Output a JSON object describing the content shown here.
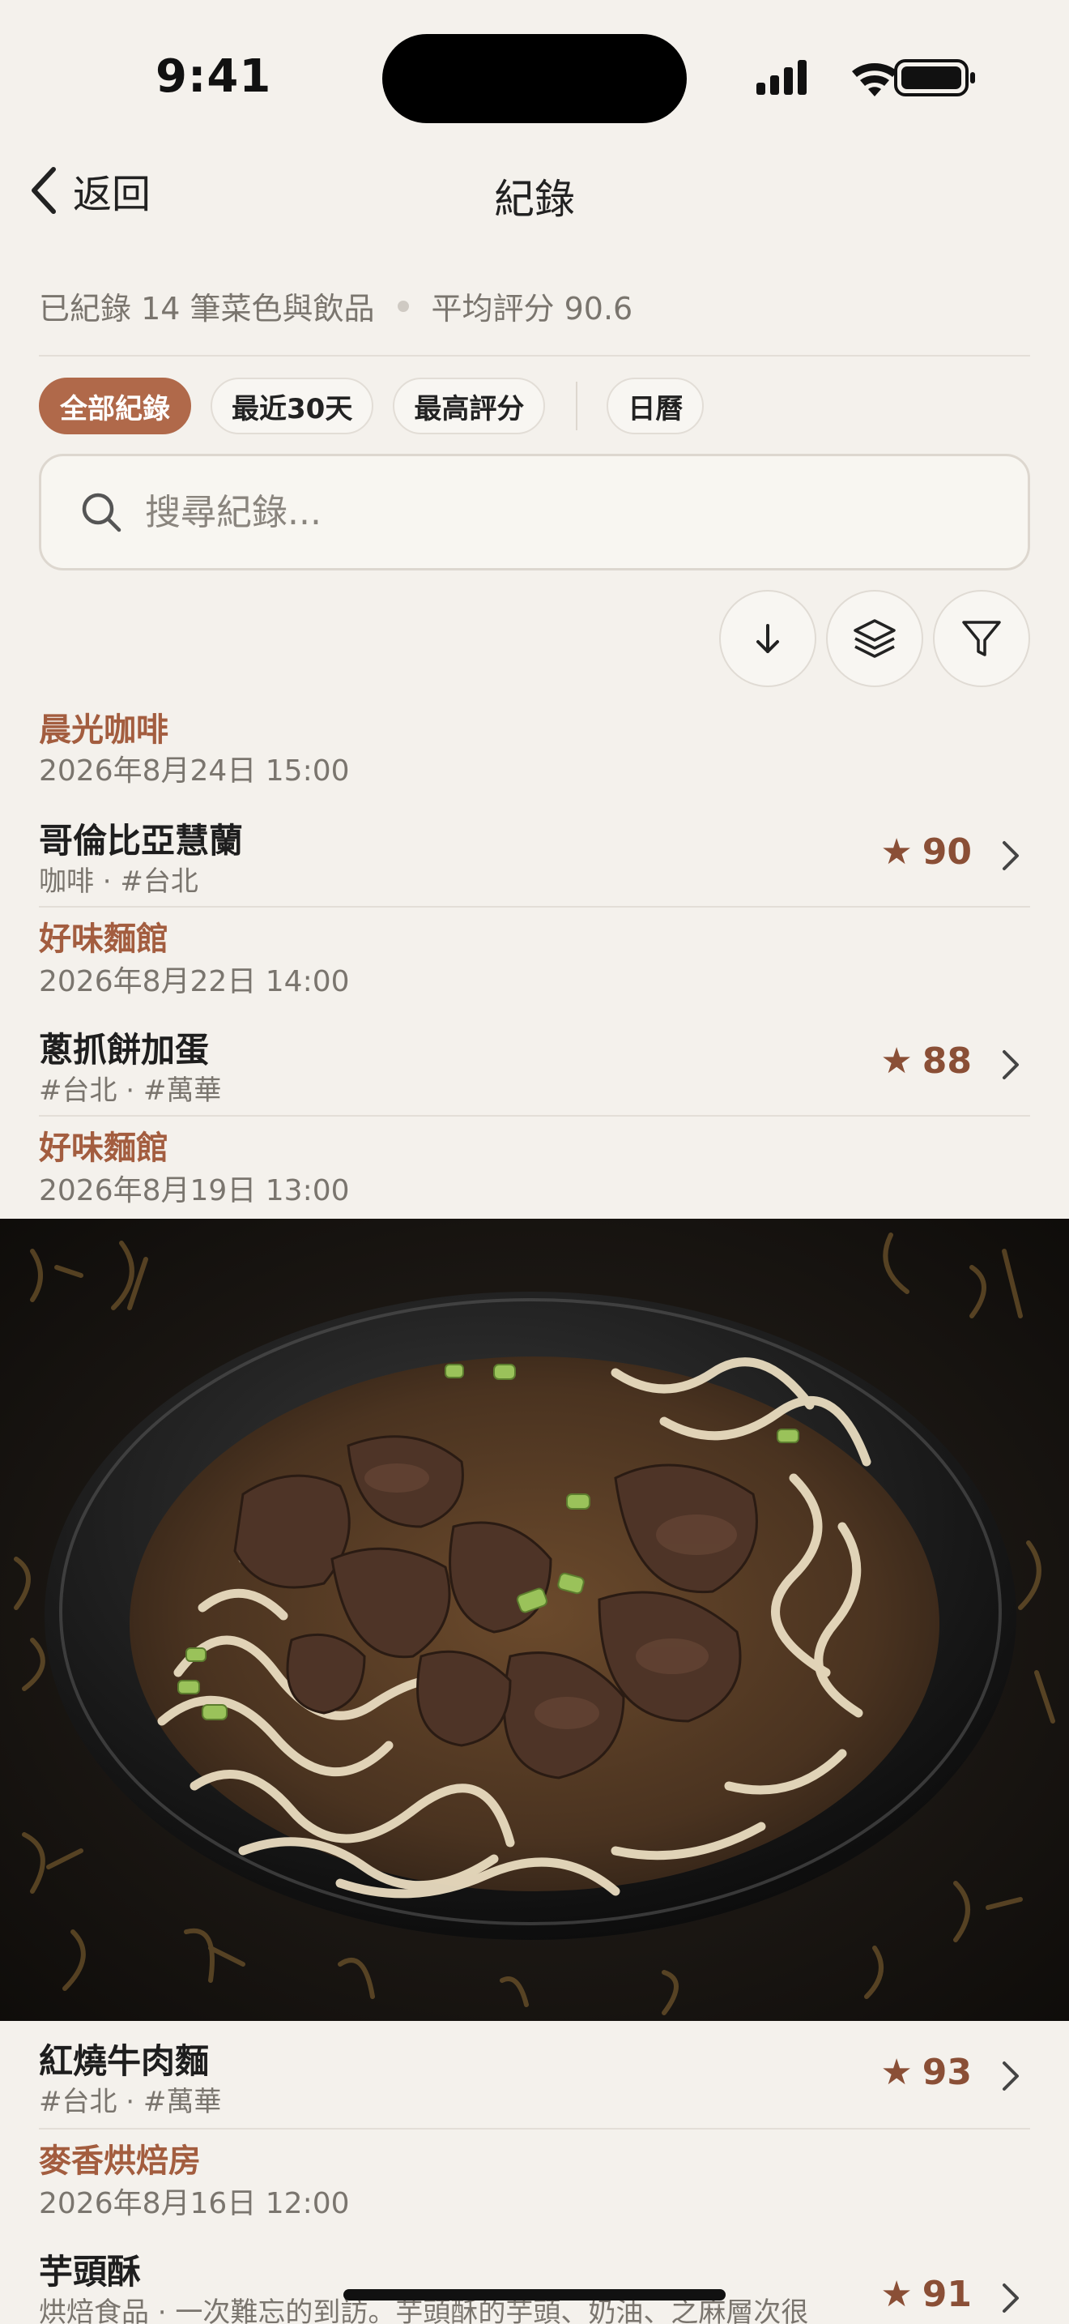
{
  "status_bar": {
    "time": "9:41"
  },
  "nav": {
    "back_label": "返回",
    "title": "紀錄"
  },
  "summary": {
    "count_text": "已紀錄 14 筆菜色與飲品",
    "avg_text": "平均評分 90.6"
  },
  "filters": [
    "全部紀錄",
    "最近30天",
    "最高評分",
    "日曆"
  ],
  "search": {
    "placeholder": "搜尋紀錄..."
  },
  "tools": [
    "arrow-down-icon",
    "layers-icon",
    "filter-icon"
  ],
  "entries": [
    {
      "place": "晨光咖啡",
      "datetime": "2026年8月24日 15:00",
      "name": "哥倫比亞慧蘭",
      "tags": "咖啡 · #台北",
      "score": "90"
    },
    {
      "place": "好味麵館",
      "datetime": "2026年8月22日 14:00",
      "name": "蔥抓餅加蛋",
      "tags": "#台北 · #萬華",
      "score": "88"
    },
    {
      "place": "好味麵館",
      "datetime": "2026年8月19日 13:00",
      "name": "紅燒牛肉麵",
      "tags": "#台北 · #萬華",
      "score": "93",
      "photo": "beef-noodle-soup-photo"
    },
    {
      "place": "麥香烘焙房",
      "datetime": "2026年8月16日 12:00",
      "name": "芋頭酥",
      "tags": "烘焙食品 · 一次難忘的到訪。芋頭酥的芋頭、奶油、之麻層次很",
      "score": "91"
    }
  ],
  "colors": {
    "accent": "#b0694a",
    "place": "#a35d3f",
    "score": "#8a4f36",
    "background": "#f4f1ec"
  }
}
